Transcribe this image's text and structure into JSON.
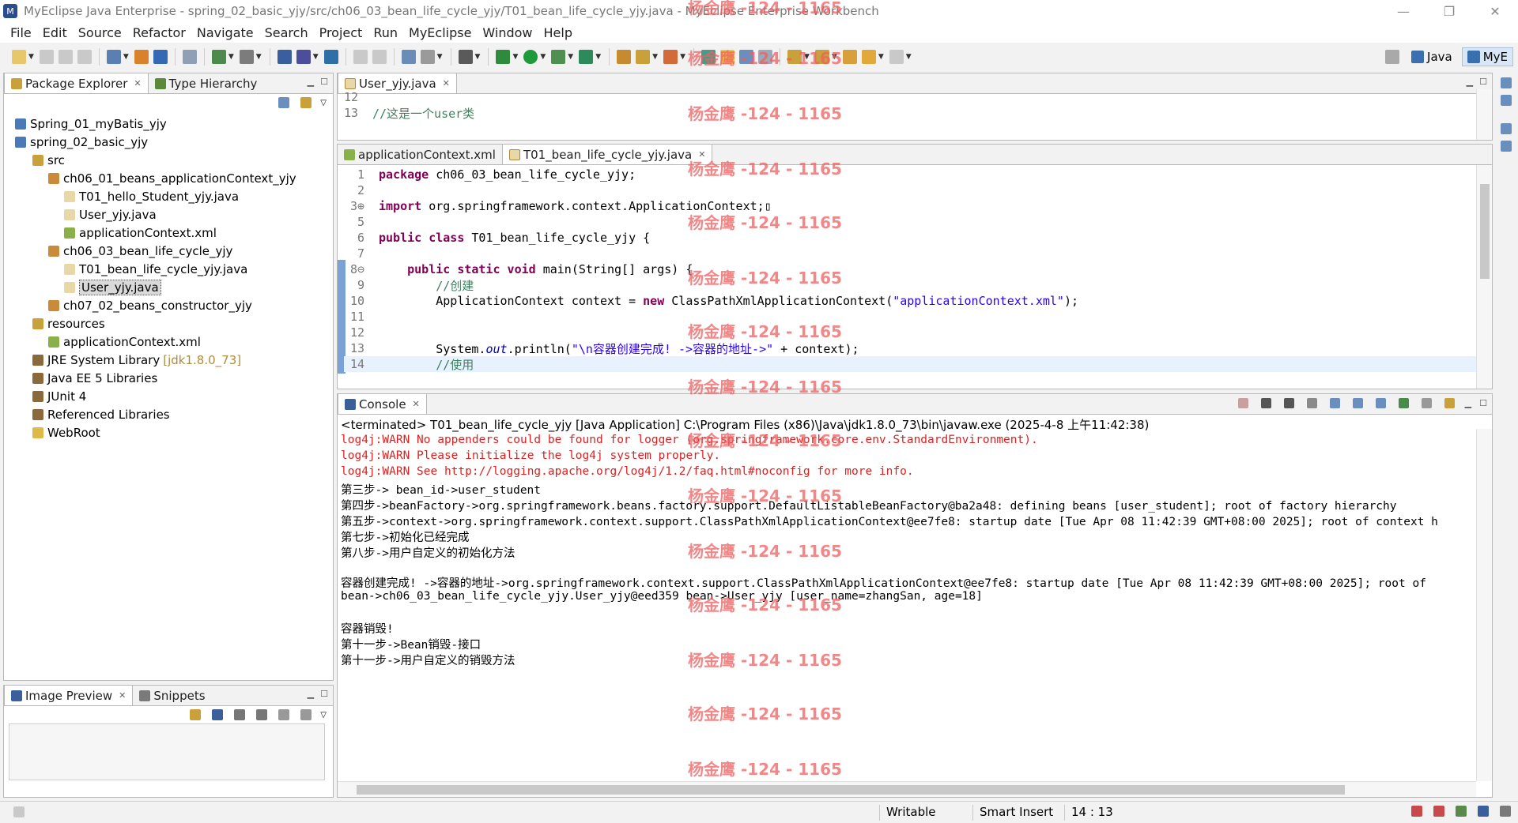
{
  "window": {
    "title": "MyEclipse Java Enterprise - spring_02_basic_yjy/src/ch06_03_bean_life_cycle_yjy/T01_bean_life_cycle_yjy.java - MyEclipse Enterprise Workbench",
    "minimize": "—",
    "restore": "❐",
    "close": "✕"
  },
  "menu": [
    "File",
    "Edit",
    "Source",
    "Refactor",
    "Navigate",
    "Search",
    "Project",
    "Run",
    "MyEclipse",
    "Window",
    "Help"
  ],
  "perspectives": [
    {
      "label": "Java",
      "active": false
    },
    {
      "label": "MyE",
      "active": true
    }
  ],
  "package_explorer": {
    "tabs": [
      {
        "label": "Package Explorer",
        "close": "✕"
      },
      {
        "label": "Type Hierarchy"
      }
    ],
    "tree": [
      {
        "label": "Spring_01_myBatis_yjy",
        "icon": "project-icon"
      },
      {
        "label": "spring_02_basic_yjy",
        "icon": "project-icon"
      },
      {
        "label": "src",
        "icon": "source-folder-icon"
      },
      {
        "label": "ch06_01_beans_applicationContext_yjy",
        "icon": "package-icon"
      },
      {
        "label": "T01_hello_Student_yjy.java",
        "icon": "java-file-icon"
      },
      {
        "label": "User_yjy.java",
        "icon": "java-file-icon"
      },
      {
        "label": "applicationContext.xml",
        "icon": "xml-file-icon"
      },
      {
        "label": "ch06_03_bean_life_cycle_yjy",
        "icon": "package-icon"
      },
      {
        "label": "T01_bean_life_cycle_yjy.java",
        "icon": "java-file-icon"
      },
      {
        "label": "User_yjy.java",
        "icon": "java-file-icon"
      },
      {
        "label": "ch07_02_beans_constructor_yjy",
        "icon": "package-icon"
      },
      {
        "label": "resources",
        "icon": "source-folder-icon"
      },
      {
        "label": "applicationContext.xml",
        "icon": "xml-file-icon"
      },
      {
        "label": "JRE System Library",
        "extra": "[jdk1.8.0_73]",
        "icon": "library-icon"
      },
      {
        "label": "Java EE 5 Libraries",
        "icon": "library-icon"
      },
      {
        "label": "JUnit 4",
        "icon": "library-icon"
      },
      {
        "label": "Referenced Libraries",
        "icon": "library-icon"
      },
      {
        "label": "WebRoot",
        "icon": "folder-icon"
      }
    ]
  },
  "image_preview": {
    "tabs": [
      {
        "label": "Image Preview",
        "close": "✕"
      },
      {
        "label": "Snippets"
      }
    ]
  },
  "editor_user": {
    "tab": "User_yjy.java",
    "close": "✕",
    "lines": [
      {
        "n": "12",
        "text": ""
      },
      {
        "n": "13",
        "text": "//这是一个user类"
      }
    ]
  },
  "editor_main": {
    "tabs": [
      {
        "label": "applicationContext.xml"
      },
      {
        "label": "T01_bean_life_cycle_yjy.java",
        "close": "✕"
      }
    ],
    "lines": [
      {
        "n": "1",
        "parts": [
          {
            "k": "kw",
            "t": "package"
          },
          {
            "k": "",
            "t": " ch06_03_bean_life_cycle_yjy;"
          }
        ]
      },
      {
        "n": "2",
        "parts": []
      },
      {
        "n": "3⊕",
        "parts": [
          {
            "k": "kw",
            "t": "import"
          },
          {
            "k": "",
            "t": " org.springframework.context.ApplicationContext;▯"
          }
        ]
      },
      {
        "n": "5",
        "parts": []
      },
      {
        "n": "6",
        "parts": [
          {
            "k": "kw",
            "t": "public class"
          },
          {
            "k": "",
            "t": " T01_bean_life_cycle_yjy {"
          }
        ]
      },
      {
        "n": "7",
        "parts": []
      },
      {
        "n": "8⊖",
        "parts": [
          {
            "k": "",
            "t": "    "
          },
          {
            "k": "kw",
            "t": "public static void"
          },
          {
            "k": "",
            "t": " main(String[] args) {"
          }
        ]
      },
      {
        "n": "9",
        "parts": [
          {
            "k": "cm",
            "t": "        //创建"
          }
        ]
      },
      {
        "n": "10",
        "parts": [
          {
            "k": "",
            "t": "        ApplicationContext context = "
          },
          {
            "k": "kw",
            "t": "new"
          },
          {
            "k": "",
            "t": " ClassPathXmlApplicationContext("
          },
          {
            "k": "str",
            "t": "\"applicationContext.xml\""
          },
          {
            "k": "",
            "t": ");"
          }
        ]
      },
      {
        "n": "11",
        "parts": []
      },
      {
        "n": "12",
        "parts": []
      },
      {
        "n": "13",
        "parts": [
          {
            "k": "",
            "t": "        System."
          },
          {
            "k": "fld",
            "t": "out"
          },
          {
            "k": "",
            "t": ".println("
          },
          {
            "k": "str",
            "t": "\"\\n容器创建完成! ->容器的地址->\""
          },
          {
            "k": "",
            "t": " + context);"
          }
        ]
      },
      {
        "n": "14",
        "parts": [
          {
            "k": "cm",
            "t": "        //使用"
          }
        ]
      }
    ]
  },
  "console": {
    "tab": "Console",
    "close": "✕",
    "terminated": "<terminated> T01_bean_life_cycle_yjy [Java Application] C:\\Program Files (x86)\\Java\\jdk1.8.0_73\\bin\\javaw.exe (2025-4-8 上午11:42:38)",
    "lines": [
      {
        "type": "err",
        "text": "log4j:WARN No appenders could be found for logger (org.springframework.core.env.StandardEnvironment)."
      },
      {
        "type": "err",
        "text": "log4j:WARN Please initialize the log4j system properly."
      },
      {
        "type": "err",
        "text": "log4j:WARN See http://logging.apache.org/log4j/1.2/faq.html#noconfig for more info."
      },
      {
        "type": "out",
        "text": "第三步-> bean_id->user_student"
      },
      {
        "type": "out",
        "text": "第四步->beanFactory->org.springframework.beans.factory.support.DefaultListableBeanFactory@ba2a48: defining beans [user_student]; root of factory hierarchy"
      },
      {
        "type": "out",
        "text": "第五步->context->org.springframework.context.support.ClassPathXmlApplicationContext@ee7fe8: startup date [Tue Apr 08 11:42:39 GMT+08:00 2025]; root of context h"
      },
      {
        "type": "out",
        "text": "第七步->初始化已经完成"
      },
      {
        "type": "out",
        "text": "第八步->用户自定义的初始化方法"
      },
      {
        "type": "gap",
        "text": ""
      },
      {
        "type": "out",
        "text": "容器创建完成! ->容器的地址->org.springframework.context.support.ClassPathXmlApplicationContext@ee7fe8: startup date [Tue Apr 08 11:42:39 GMT+08:00 2025]; root of"
      },
      {
        "type": "out",
        "text": "bean->ch06_03_bean_life_cycle_yjy.User_yjy@eed359 bean->User_yjy [user_name=zhangSan, age=18]"
      },
      {
        "type": "gap",
        "text": ""
      },
      {
        "type": "out",
        "text": "容器销毁!"
      },
      {
        "type": "out",
        "text": "第十一步->Bean销毁-接口"
      },
      {
        "type": "out",
        "text": "第十一步->用户自定义的销毁方法"
      }
    ]
  },
  "status": {
    "writable": "Writable",
    "insert_mode": "Smart Insert",
    "position": "14 : 13"
  },
  "watermark": "杨金鹰 -124 - 1165",
  "colors": {
    "keyword": "#7f0055",
    "comment": "#3f7f5f",
    "string": "#2a00ff",
    "error": "#e02020",
    "selection": "#d9e6f5"
  }
}
